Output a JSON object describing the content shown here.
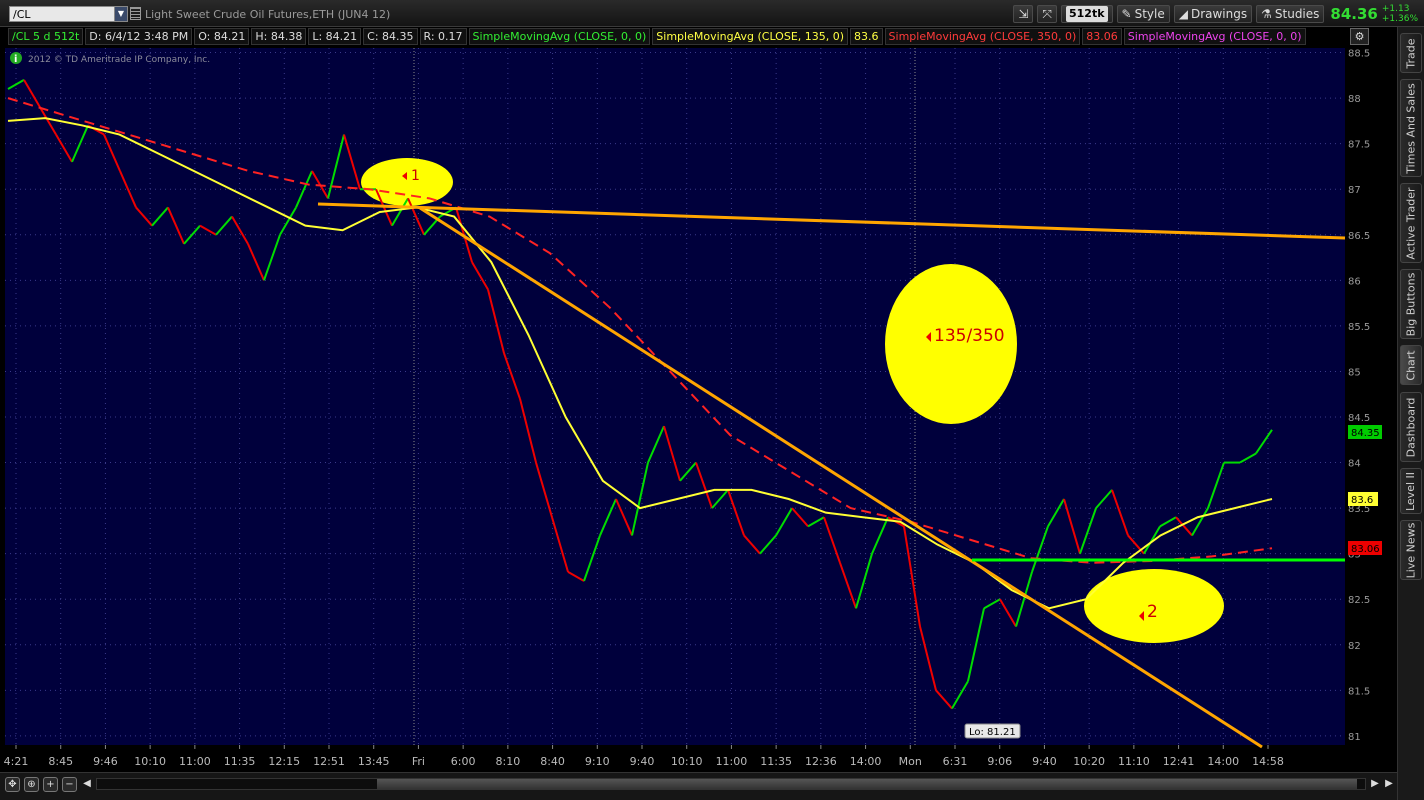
{
  "toolbar": {
    "symbol": "/CL",
    "instrument_title": "Light Sweet Crude Oil Futures,ETH (JUN4 12)",
    "tick_badge": "512tk",
    "style_label": "Style",
    "drawings_label": "Drawings",
    "studies_label": "Studies",
    "last_price": "84.36",
    "net_change": "+1.13",
    "pct_change": "+1.36%"
  },
  "infobar": {
    "symbol_cell": "/CL 5 d 512t",
    "date_cell": "D: 6/4/12 3:48 PM",
    "open_cell": "O: 84.21",
    "high_cell": "H: 84.38",
    "low_cell": "L: 84.21",
    "close_cell": "C: 84.35",
    "range_cell": "R: 0.17",
    "sma1": "SimpleMovingAvg (CLOSE, 0, 0)",
    "sma2": "SimpleMovingAvg (CLOSE, 135, 0)",
    "sma2_val": "83.6",
    "sma3": "SimpleMovingAvg (CLOSE, 350, 0)",
    "sma3_val": "83.06",
    "sma4": "SimpleMovingAvg (CLOSE, 0, 0)"
  },
  "chart_data": {
    "type": "line",
    "copyright": "2012 © TD Ameritrade IP Company, Inc.",
    "ylim": [
      80.9,
      88.55
    ],
    "y_ticks": [
      "81",
      "81.5",
      "82",
      "82.5",
      "83",
      "83.5",
      "84",
      "84.5",
      "85",
      "85.5",
      "86",
      "86.5",
      "87",
      "87.5",
      "88",
      "88.5"
    ],
    "x_ticks": [
      "4:21",
      "8:45",
      "9:46",
      "10:10",
      "11:00",
      "11:35",
      "12:15",
      "12:51",
      "13:45",
      "Fri",
      "6:00",
      "8:10",
      "8:40",
      "9:10",
      "9:40",
      "10:10",
      "11:00",
      "11:35",
      "12:36",
      "14:00",
      "Mon",
      "6:31",
      "9:06",
      "9:40",
      "10:20",
      "11:10",
      "12:41",
      "14:00",
      "14:58"
    ],
    "series": [
      {
        "values": [
          88.1,
          88.2,
          87.9,
          87.6,
          87.3,
          87.7,
          87.6,
          87.2,
          86.8,
          86.6,
          86.8,
          86.4,
          86.6,
          86.5,
          86.7,
          86.4,
          86.0,
          86.5,
          86.8,
          87.2,
          86.9,
          87.6,
          87.0,
          87.0,
          86.6,
          86.9,
          86.5,
          86.7,
          86.8,
          86.2,
          85.9,
          85.2,
          84.7,
          84.0,
          83.4,
          82.8,
          82.7,
          83.2,
          83.6,
          83.2,
          84.0,
          84.4,
          83.8,
          84.0,
          83.5,
          83.7,
          83.2,
          83.0,
          83.2,
          83.5,
          83.3,
          83.4,
          82.9,
          82.4,
          83.0,
          83.4,
          83.3,
          82.2,
          81.5,
          81.3,
          81.6,
          82.4,
          82.5,
          82.2,
          82.8,
          83.3,
          83.6,
          83.0,
          83.5,
          83.7,
          83.2,
          83.0,
          83.3,
          83.4,
          83.2,
          83.5,
          84.0,
          84.0,
          84.1,
          84.36
        ]
      },
      {
        "values": [
          87.75,
          87.78,
          87.7,
          87.6,
          87.4,
          87.2,
          87.0,
          86.8,
          86.6,
          86.55,
          86.75,
          86.8,
          86.7,
          86.2,
          85.4,
          84.5,
          83.8,
          83.5,
          83.6,
          83.7,
          83.7,
          83.6,
          83.45,
          83.4,
          83.35,
          83.1,
          82.9,
          82.6,
          82.4,
          82.5,
          82.9,
          83.2,
          83.4,
          83.5,
          83.6
        ]
      },
      {
        "values": [
          88.0,
          87.8,
          87.6,
          87.4,
          87.2,
          87.05,
          87.0,
          86.9,
          86.7,
          86.3,
          85.7,
          85.0,
          84.3,
          83.9,
          83.5,
          83.35,
          83.15,
          82.95,
          82.9,
          82.92,
          82.97,
          83.06
        ]
      }
    ],
    "annotations": [
      {
        "label": "1"
      },
      {
        "label": "135/350"
      },
      {
        "label": "2"
      },
      {
        "label": "Lo: 81.21"
      }
    ],
    "price_labels": [
      {
        "label": "84.35"
      },
      {
        "label": "83.6"
      },
      {
        "label": "83.06"
      }
    ]
  },
  "side_tabs": [
    "Trade",
    "Times And Sales",
    "Active Trader",
    "Big Buttons",
    "Chart",
    "Dashboard",
    "Level II",
    "Live News"
  ],
  "colors": {
    "background": "#000040",
    "up": "#00dd00",
    "down": "#ee0000",
    "sma135": "#ffff33",
    "sma350": "#ff2222",
    "trendline": "#ffa500",
    "support": "#00ff00",
    "highlight": "#ffff00"
  }
}
